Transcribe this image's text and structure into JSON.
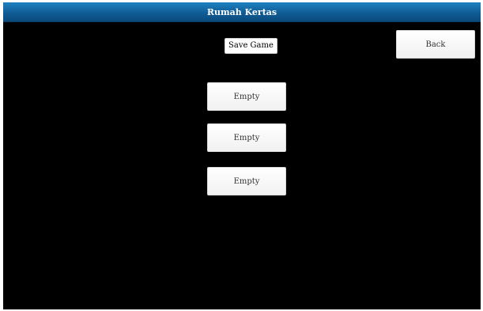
{
  "window": {
    "title": "Rumah Kertas"
  },
  "screen": {
    "heading": "Save Game",
    "back_label": "Back",
    "slots": [
      {
        "label": "Empty"
      },
      {
        "label": "Empty"
      },
      {
        "label": "Empty"
      }
    ]
  },
  "colors": {
    "titlebar": "#0f5a92",
    "background": "#000000",
    "button": "#ffffff"
  }
}
